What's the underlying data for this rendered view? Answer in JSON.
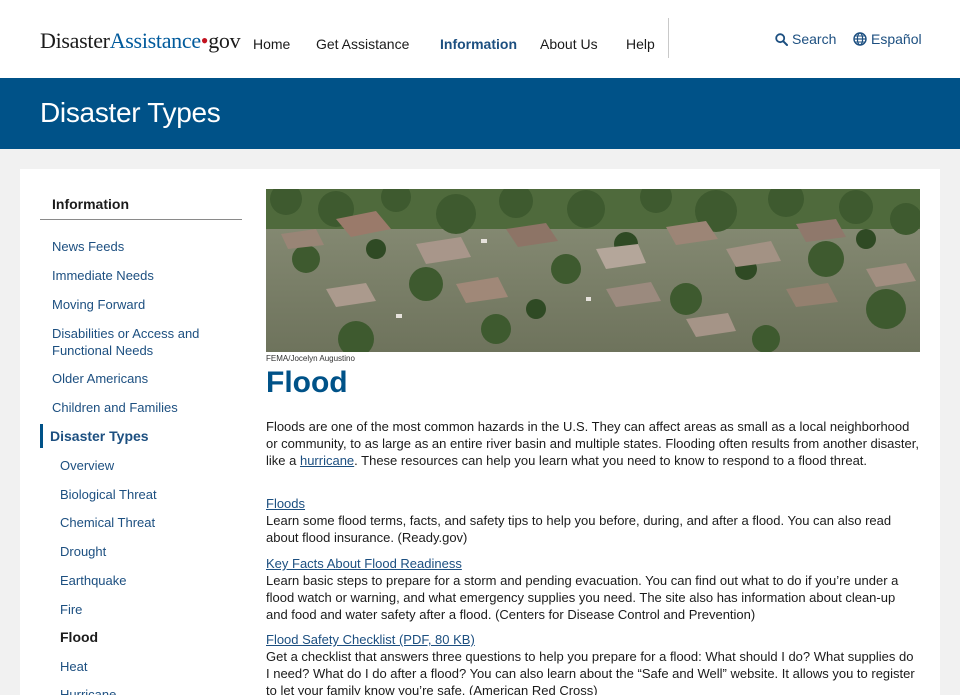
{
  "header": {
    "logo": {
      "part1": "Disaster",
      "part2": "Assistance",
      "dot": "•",
      "part3": "gov"
    },
    "nav": [
      {
        "label": "Home"
      },
      {
        "label": "Get Assistance"
      },
      {
        "label": "Information"
      },
      {
        "label": "About Us"
      },
      {
        "label": "Help"
      }
    ],
    "search_label": "Search",
    "language_label": "Español"
  },
  "banner": {
    "title": "Disaster Types"
  },
  "sidebar": {
    "heading": "Information",
    "items": [
      {
        "label": "News Feeds"
      },
      {
        "label": "Immediate Needs"
      },
      {
        "label": "Moving Forward"
      },
      {
        "label": "Disabilities or Access and Functional Needs"
      },
      {
        "label": "Older Americans"
      },
      {
        "label": "Children and Families"
      },
      {
        "label": "Disaster Types"
      }
    ],
    "subitems": [
      {
        "label": "Overview"
      },
      {
        "label": "Biological Threat"
      },
      {
        "label": "Chemical Threat"
      },
      {
        "label": "Drought"
      },
      {
        "label": "Earthquake"
      },
      {
        "label": "Fire"
      },
      {
        "label": "Flood"
      },
      {
        "label": "Heat"
      },
      {
        "label": "Hurricane"
      }
    ]
  },
  "main": {
    "image_credit": "FEMA/Jocelyn Augustino",
    "title": "Flood",
    "intro_before_link": "Floods are one of the most common hazards in the U.S. They can affect areas as small as a local neighborhood or community, to as large as an entire river basin and multiple states. Flooding often results from another disaster, like a ",
    "intro_link": "hurricane",
    "intro_after_link": ". These resources can help you learn what you need to know to respond to a flood threat.",
    "resources": [
      {
        "title": "Floods",
        "description": "Learn some flood terms, facts, and safety tips to help you before, during, and after a flood. You can also read about flood insurance. (Ready.gov)"
      },
      {
        "title": "Key Facts About Flood Readiness",
        "description": "Learn basic steps to prepare for a storm and pending evacuation. You can find out what to do if you’re under a flood watch or warning, and what emergency supplies you need. The site also has information about clean-up and food and water safety after a flood. (Centers for Disease Control and Prevention)"
      },
      {
        "title": "Flood Safety Checklist (PDF, 80 KB)",
        "description": "Get a checklist that answers three questions to help you prepare for a flood: What should I do? What supplies do I need? What do I do after a flood? You can also learn about the “Safe and Well” website. It allows you to register to let your family know you’re safe. (American Red Cross)"
      }
    ]
  },
  "colors": {
    "brand_blue": "#005288",
    "link_blue": "#1c4f80",
    "logo_red": "#c2121f"
  }
}
